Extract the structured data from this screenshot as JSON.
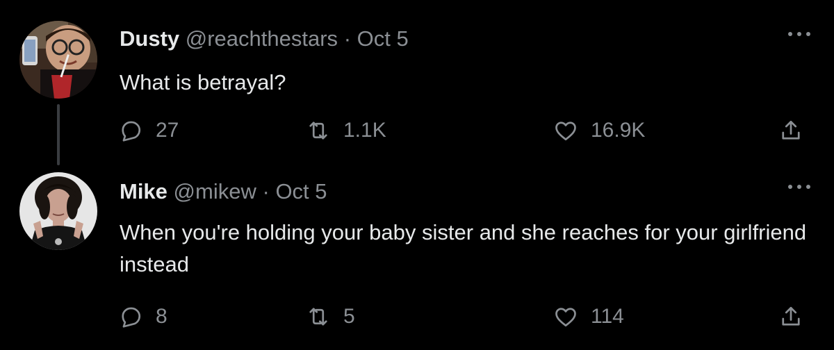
{
  "tweets": [
    {
      "name": "Dusty",
      "handle": "@reachthestars",
      "separator": "·",
      "date": "Oct 5",
      "text": "What is betrayal?",
      "replies": "27",
      "retweets": "1.1K",
      "likes": "16.9K",
      "icons": [
        "reply-icon",
        "retweet-icon",
        "heart-icon",
        "share-icon",
        "more-icon"
      ]
    },
    {
      "name": "Mike",
      "handle": "@mikew",
      "separator": "·",
      "date": "Oct 5",
      "text": "When you're holding your baby sister and she reaches for your girlfriend instead",
      "replies": "8",
      "retweets": "5",
      "likes": "114",
      "icons": [
        "reply-icon",
        "retweet-icon",
        "heart-icon",
        "share-icon",
        "more-icon"
      ]
    }
  ],
  "colors": {
    "background": "#000000",
    "primary_text": "#e7e9ea",
    "secondary_text": "#8b8f94",
    "thread_line": "#3a3d41"
  }
}
